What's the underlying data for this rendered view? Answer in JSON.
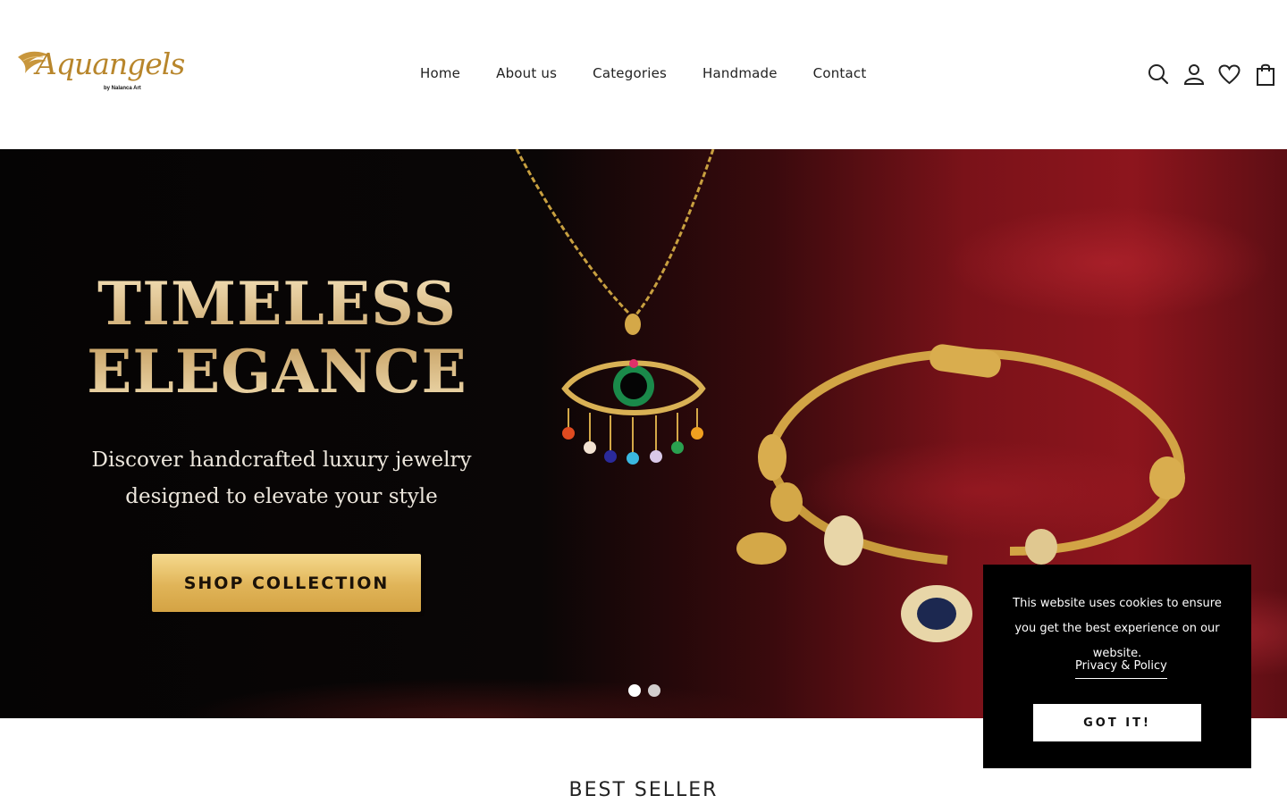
{
  "brand": {
    "logo_text": "Aquangels",
    "logo_byline": "by Nalanca Art",
    "accent_color": "#c8963c"
  },
  "nav": {
    "items": [
      {
        "label": "Home"
      },
      {
        "label": "About us"
      },
      {
        "label": "Categories"
      },
      {
        "label": "Handmade"
      },
      {
        "label": "Contact"
      }
    ]
  },
  "header_icons": [
    "search-icon",
    "account-icon",
    "wishlist-heart-icon",
    "cart-bag-icon"
  ],
  "hero": {
    "title_line1": "TIMELESS",
    "title_line2": "ELEGANCE",
    "subtitle_line1": "Discover handcrafted luxury jewelry",
    "subtitle_line2": "designed to elevate your style",
    "cta_label": "SHOP COLLECTION",
    "slides_count": 2,
    "active_slide": 1
  },
  "cookie": {
    "message": "This website uses cookies to ensure you get the best experience on our website.",
    "policy_link": "Privacy & Policy",
    "accept_label": "GOT IT!"
  },
  "section": {
    "title": "BEST SELLER"
  }
}
